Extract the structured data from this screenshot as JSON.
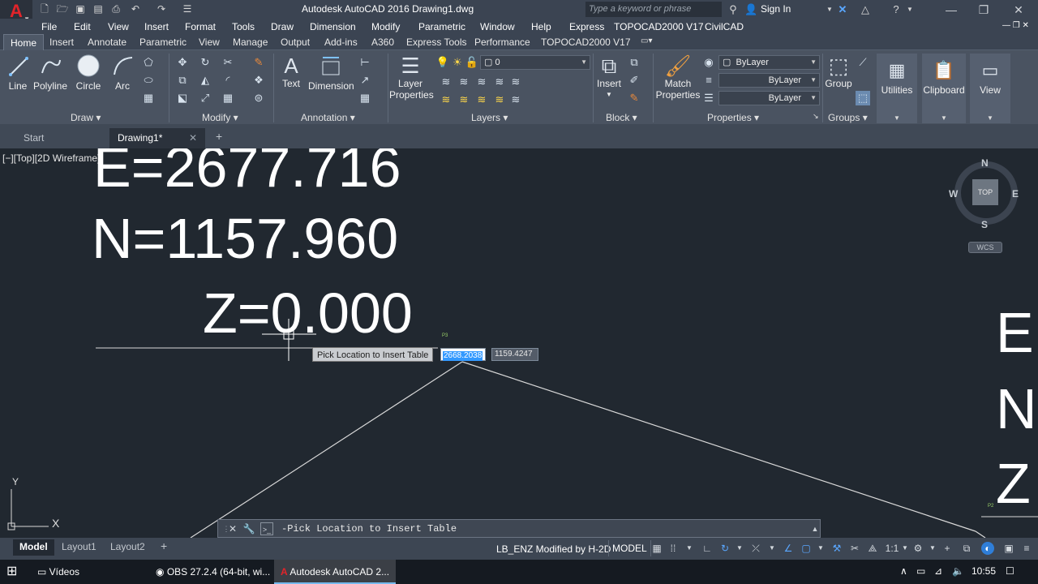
{
  "window": {
    "title": "Autodesk AutoCAD 2016    Drawing1.dwg",
    "search_placeholder": "Type a keyword or phrase",
    "sign_in": "Sign In",
    "logo_letter": "A"
  },
  "menu": [
    "File",
    "Edit",
    "View",
    "Insert",
    "Format",
    "Tools",
    "Draw",
    "Dimension",
    "Modify",
    "Parametric",
    "Window",
    "Help",
    "Express",
    "TOPOCAD2000 V17",
    "CivilCAD"
  ],
  "ribbon_tabs": [
    "Home",
    "Insert",
    "Annotate",
    "Parametric",
    "View",
    "Manage",
    "Output",
    "Add-ins",
    "A360",
    "Express Tools",
    "Performance",
    "TOPOCAD2000 V17"
  ],
  "ribbon": {
    "draw": {
      "line": "Line",
      "polyline": "Polyline",
      "circle": "Circle",
      "arc": "Arc",
      "label": "Draw"
    },
    "modify": {
      "label": "Modify"
    },
    "annotation": {
      "text": "Text",
      "dimension": "Dimension",
      "label": "Annotation"
    },
    "layers": {
      "layer_properties": "Layer\nProperties",
      "layer_properties_1": "Layer",
      "layer_properties_2": "Properties",
      "current_layer": "0",
      "label": "Layers"
    },
    "block": {
      "insert": "Insert",
      "label": "Block"
    },
    "properties": {
      "match_1": "Match",
      "match_2": "Properties",
      "color": "ByLayer",
      "linetype": "ByLayer",
      "lineweight": "ByLayer",
      "label": "Properties"
    },
    "groups": {
      "group": "Group",
      "label": "Groups"
    },
    "utilities": "Utilities",
    "clipboard": "Clipboard",
    "view": "View"
  },
  "file_tabs": {
    "start": "Start",
    "drawing": "Drawing1*"
  },
  "viewport": {
    "label": "[−][Top][2D Wireframe]",
    "text_e": "E=2677.716",
    "text_n": "N=1157.960",
    "text_z": "Z=0.000",
    "right_e": "E",
    "right_n": "N",
    "right_z": "Z",
    "p_label_1": "P3",
    "p_label_2": "P2"
  },
  "viewcube": {
    "n": "N",
    "s": "S",
    "e": "E",
    "w": "W",
    "top": "TOP",
    "wcs": "WCS"
  },
  "tooltip": "Pick Location to Insert Table",
  "dynamic_input": {
    "x": "2668.2038",
    "y": "1159.4247"
  },
  "ucs": {
    "x": "X",
    "y": "Y"
  },
  "command_line": {
    "prompt": "‐Pick Location to Insert Table"
  },
  "layout_tabs": [
    "Model",
    "Layout1",
    "Layout2"
  ],
  "status": {
    "message": "LB_ENZ Modified by H-2D",
    "model": "MODEL",
    "scale": "1:1"
  },
  "taskbar": {
    "items": [
      "Vídeos",
      "OBS 27.2.4 (64-bit, wi...",
      "Autodesk AutoCAD 2..."
    ],
    "time": "10:55"
  },
  "colors": {
    "canvas": "#212830",
    "ribbon": "#4a5361",
    "accent": "#3399ff",
    "logo": "#e2242a"
  }
}
